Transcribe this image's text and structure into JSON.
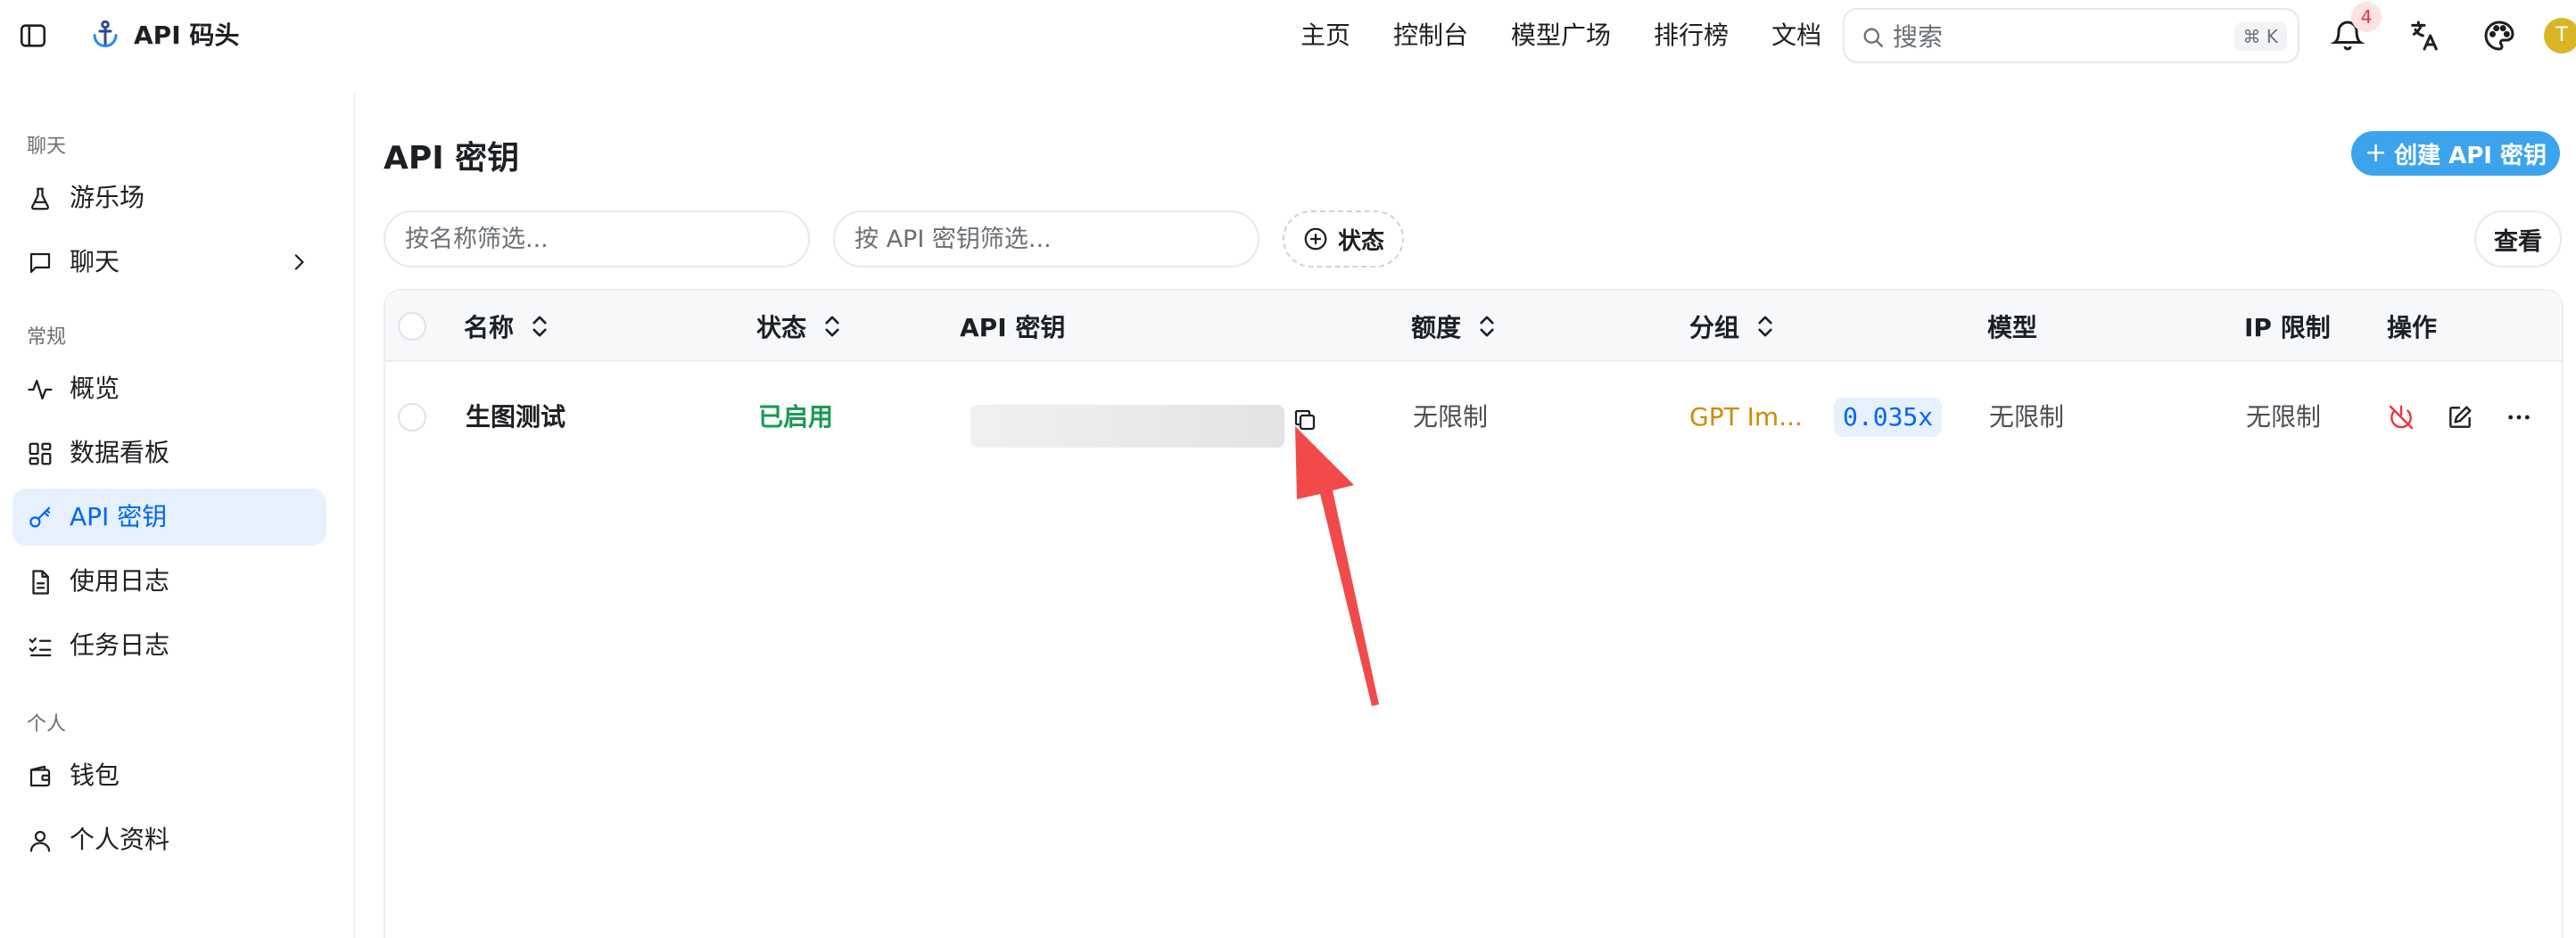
{
  "topbar": {
    "brand_name": "API 码头",
    "nav": [
      "主页",
      "控制台",
      "模型广场",
      "排行榜",
      "文档"
    ],
    "search_placeholder": "搜索",
    "search_shortcut": "⌘ K",
    "notification_count": "4",
    "avatar_initial": "T"
  },
  "sidebar": {
    "sections": {
      "chat": "聊天",
      "general": "常规",
      "personal": "个人"
    },
    "items": [
      {
        "label": "游乐场",
        "icon": "flask-icon"
      },
      {
        "label": "聊天",
        "icon": "message-square-icon"
      },
      {
        "label": "概览",
        "icon": "activity-icon"
      },
      {
        "label": "数据看板",
        "icon": "dashboard-grid-icon"
      },
      {
        "label": "API 密钥",
        "icon": "key-icon",
        "active": true
      },
      {
        "label": "使用日志",
        "icon": "file-text-icon"
      },
      {
        "label": "任务日志",
        "icon": "list-checks-icon"
      },
      {
        "label": "钱包",
        "icon": "wallet-icon"
      },
      {
        "label": "个人资料",
        "icon": "user-icon"
      }
    ]
  },
  "main": {
    "title": "API 密钥",
    "create_button": "创建 API 密钥",
    "filter_name_placeholder": "按名称筛选...",
    "filter_key_placeholder": "按 API 密钥筛选...",
    "status_filter": "状态",
    "view_button": "查看",
    "columns": [
      "名称",
      "状态",
      "API 密钥",
      "额度",
      "分组",
      "模型",
      "IP 限制",
      "操作"
    ],
    "rows": [
      {
        "name": "生图测试",
        "status": "已启用",
        "quota": "无限制",
        "group": "GPT Im...",
        "ratio": "0.035x",
        "models": "无限制",
        "ip_limit": "无限制"
      }
    ]
  },
  "colors": {
    "accent": "#0064fa",
    "create_button": "#3ba4ec",
    "status_enabled": "#189b53",
    "group": "#d08a00",
    "danger": "#e7363d",
    "annotation_arrow": "#f24a4a"
  }
}
